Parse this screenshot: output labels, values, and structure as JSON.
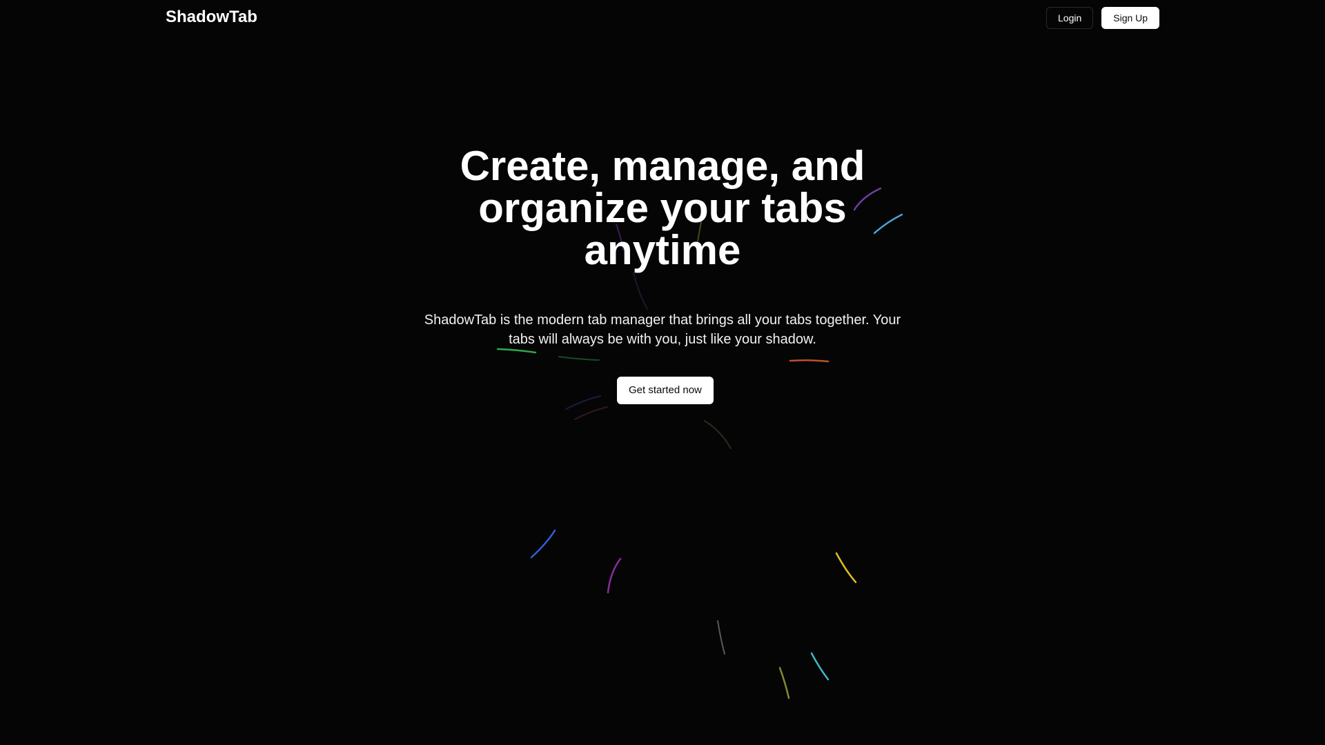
{
  "navbar": {
    "brand": "ShadowTab",
    "login_label": "Login",
    "signup_label": "Sign Up"
  },
  "hero": {
    "title": "Create, manage, and organize your tabs anytime",
    "subtitle": "ShadowTab is the modern tab manager that brings all your tabs together. Your tabs will always be with you, just like your shadow.",
    "cta_label": "Get started now"
  },
  "colors": {
    "background": "#050505",
    "text": "#ffffff",
    "button_background": "#ffffff",
    "button_text": "#0a0a0a",
    "streaks": [
      "#6b3fa0",
      "#4aa3d8",
      "#2ea84a",
      "#c0502a",
      "#2f62d8",
      "#8a2aa0",
      "#e0c020",
      "#3fb8c8",
      "#8a8a30"
    ]
  }
}
